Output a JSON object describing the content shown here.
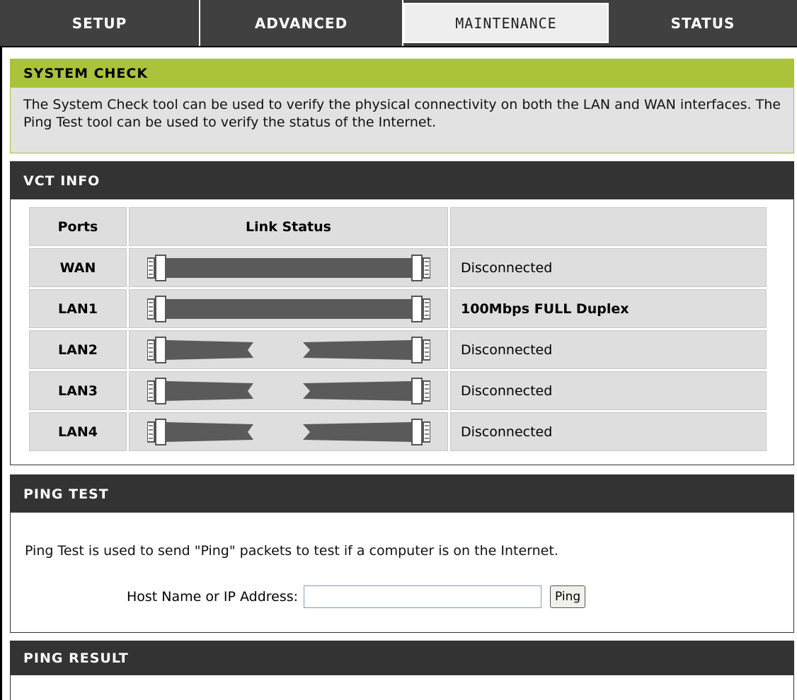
{
  "tabs": [
    "SETUP",
    "ADVANCED",
    "MAINTENANCE",
    "STATUS"
  ],
  "active_tab": "MAINTENANCE",
  "system_check": {
    "title": "SYSTEM CHECK",
    "description": "The System Check tool can be used to verify the physical connectivity on both the LAN and WAN interfaces. The Ping Test tool can be used to verify the status of the Internet."
  },
  "vct": {
    "title": "VCT INFO",
    "headers": {
      "ports": "Ports",
      "link_status": "Link Status"
    },
    "rows": [
      {
        "port": "WAN",
        "connected": true,
        "status": "Disconnected",
        "bold": false
      },
      {
        "port": "LAN1",
        "connected": true,
        "status": "100Mbps FULL Duplex",
        "bold": true
      },
      {
        "port": "LAN2",
        "connected": false,
        "status": "Disconnected",
        "bold": false
      },
      {
        "port": "LAN3",
        "connected": false,
        "status": "Disconnected",
        "bold": false
      },
      {
        "port": "LAN4",
        "connected": false,
        "status": "Disconnected",
        "bold": false
      }
    ]
  },
  "ping_test": {
    "title": "PING TEST",
    "description": "Ping Test is used to send \"Ping\" packets to test if a computer is on the Internet.",
    "host_label": "Host Name or IP Address:",
    "host_value": "",
    "button_label": "Ping"
  },
  "ping_result": {
    "title": "PING RESULT"
  },
  "colors": {
    "tab_bg": "#404040",
    "section_header": "#333333",
    "system_check_bar": "#a9c43a",
    "cell_bg": "#dedede"
  }
}
